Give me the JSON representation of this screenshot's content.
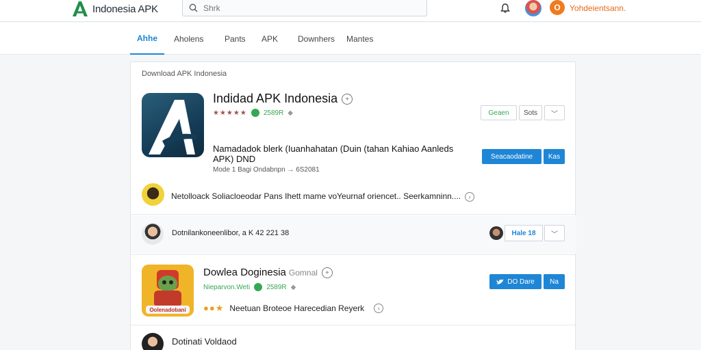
{
  "header": {
    "brand": "Indonesia APK",
    "search_placeholder": "Shrk",
    "notif_badge": "O",
    "username": "Yohdeientsann."
  },
  "nav": {
    "tabs": [
      {
        "label": "Ahhe",
        "active": true
      },
      {
        "label": "Aholens"
      },
      {
        "label": "Pants"
      },
      {
        "label": "APK"
      },
      {
        "label": "Downhers"
      },
      {
        "label": "Mantes"
      }
    ]
  },
  "card": {
    "breadcrumb": "Download APK Indonesia",
    "app": {
      "title": "Indidad APK Indonesia",
      "stars": "★★★★★",
      "count": "2589R",
      "btn_green": "Geaen",
      "btn_sort": "Sots",
      "description": "Namadadok blerk (Iuanhahatan (Duin (tahan Kahiao Aanleds APK) DND",
      "subdescription": "Mode 1 Bagi Ondabnpn → 6S2081",
      "btn_primary": "Seacaodatine",
      "btn_primary2": "Kas"
    },
    "row1": {
      "text": "Netolloack Soliacloeodar Pans Ihett mame voYeurnaf oriencet.. Seerkamninn...."
    },
    "row2": {
      "text": "Dotnilankoneenlibor, a K 42 221 38",
      "btn_label": "Hale 18"
    },
    "app2": {
      "title": "Dowlea Doginesia",
      "subtitle": "Gomnal",
      "meta": "Nieparvon.Weti",
      "count": "2589R",
      "icon_caption": "Oolenadobani",
      "stars": "●●★",
      "line": "Neetuan Broteoe Harecedian Reyerk",
      "btn_primary": "DO Dare",
      "btn_primary2": "Na"
    },
    "row3": {
      "text": "Dotinati Voldaod"
    }
  },
  "colors": {
    "accent": "#1f86d6",
    "green": "#35a853",
    "orange": "#f07a1e"
  }
}
